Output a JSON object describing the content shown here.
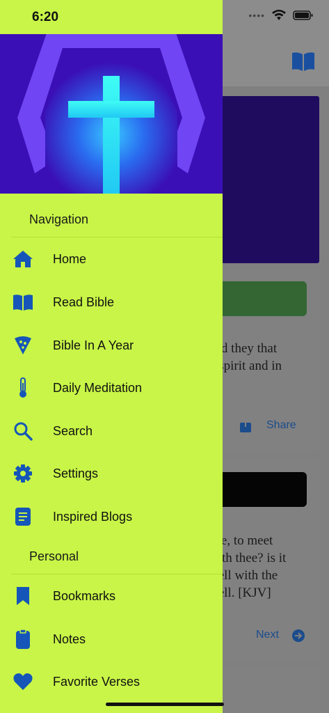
{
  "status": {
    "time": "6:20"
  },
  "drawer": {
    "sections": [
      {
        "title": "Navigation"
      },
      {
        "title": "Personal"
      }
    ],
    "nav_items": [
      {
        "label": "Home",
        "icon": "home-icon"
      },
      {
        "label": "Read Bible",
        "icon": "book-open-icon"
      },
      {
        "label": "Bible In A Year",
        "icon": "pizza-slice-icon"
      },
      {
        "label": "Daily Meditation",
        "icon": "thermometer-icon"
      },
      {
        "label": "Search",
        "icon": "search-icon"
      },
      {
        "label": "Settings",
        "icon": "gear-icon"
      },
      {
        "label": "Inspired Blogs",
        "icon": "document-icon"
      }
    ],
    "personal_items": [
      {
        "label": "Bookmarks",
        "icon": "bookmark-icon"
      },
      {
        "label": "Notes",
        "icon": "clipboard-icon"
      },
      {
        "label": "Favorite Verses",
        "icon": "heart-icon"
      }
    ]
  },
  "background": {
    "card1_text": "and they that\nn spirit and in",
    "card1_action": "Share",
    "card2_text": "hee, to meet\nwith thee? is it\nwell with the\nwell. [KJV]",
    "card2_action": "Next"
  },
  "colors": {
    "drawer_bg": "#c8f547",
    "icon": "#1556b8",
    "header_bg": "#3a0fb5",
    "cross": "#22f4f0"
  }
}
